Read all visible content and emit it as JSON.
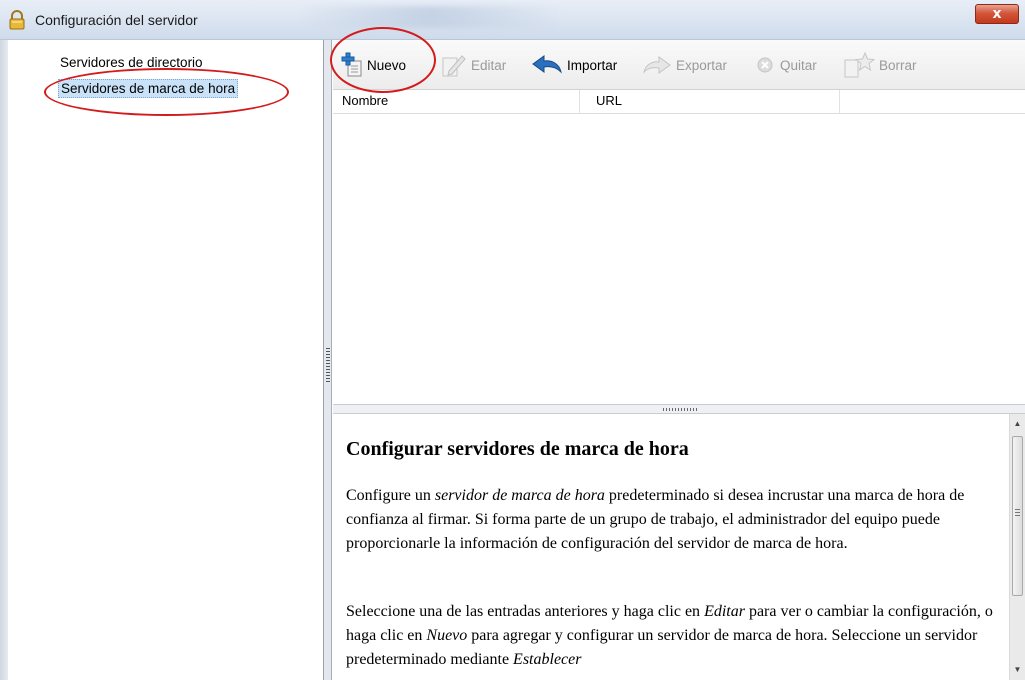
{
  "window": {
    "title": "Configuración del servidor",
    "close_label": "x"
  },
  "sidebar": {
    "items": [
      {
        "label": "Servidores de directorio"
      },
      {
        "label": "Servidores de marca de hora"
      }
    ],
    "selected_index": 1
  },
  "toolbar": {
    "buttons": [
      {
        "label": "Nuevo",
        "icon": "add-document-icon",
        "enabled": true
      },
      {
        "label": "Editar",
        "icon": "edit-icon",
        "enabled": false
      },
      {
        "label": "Importar",
        "icon": "import-arrow-icon",
        "enabled": true
      },
      {
        "label": "Exportar",
        "icon": "export-arrow-icon",
        "enabled": false
      },
      {
        "label": "Quitar",
        "icon": "remove-circle-icon",
        "enabled": false
      },
      {
        "label": "Borrar",
        "icon": "star-icon",
        "enabled": false
      }
    ]
  },
  "table": {
    "columns": [
      "Nombre",
      "URL"
    ],
    "rows": []
  },
  "help": {
    "heading": "Configurar servidores de marca de hora",
    "p1_a": "Configure un ",
    "p1_em": "servidor de marca de hora",
    "p1_b": " predeterminado si desea incrustar una marca de hora de confianza al firmar. Si forma parte de un grupo de trabajo, el administrador del equipo puede proporcionarle la información de configuración del servidor de marca de hora.",
    "p2_a": "Seleccione una de las entradas anteriores y haga clic en ",
    "p2_em1": "Editar",
    "p2_b": " para ver o cambiar la configuración, o haga clic en ",
    "p2_em2": "Nuevo",
    "p2_c": " para agregar y configurar un servidor de marca de hora. Seleccione un servidor predeterminado mediante ",
    "p2_em3": "Establecer"
  },
  "colors": {
    "annotation": "#d41b1b",
    "selection": "#c9e2f8"
  }
}
